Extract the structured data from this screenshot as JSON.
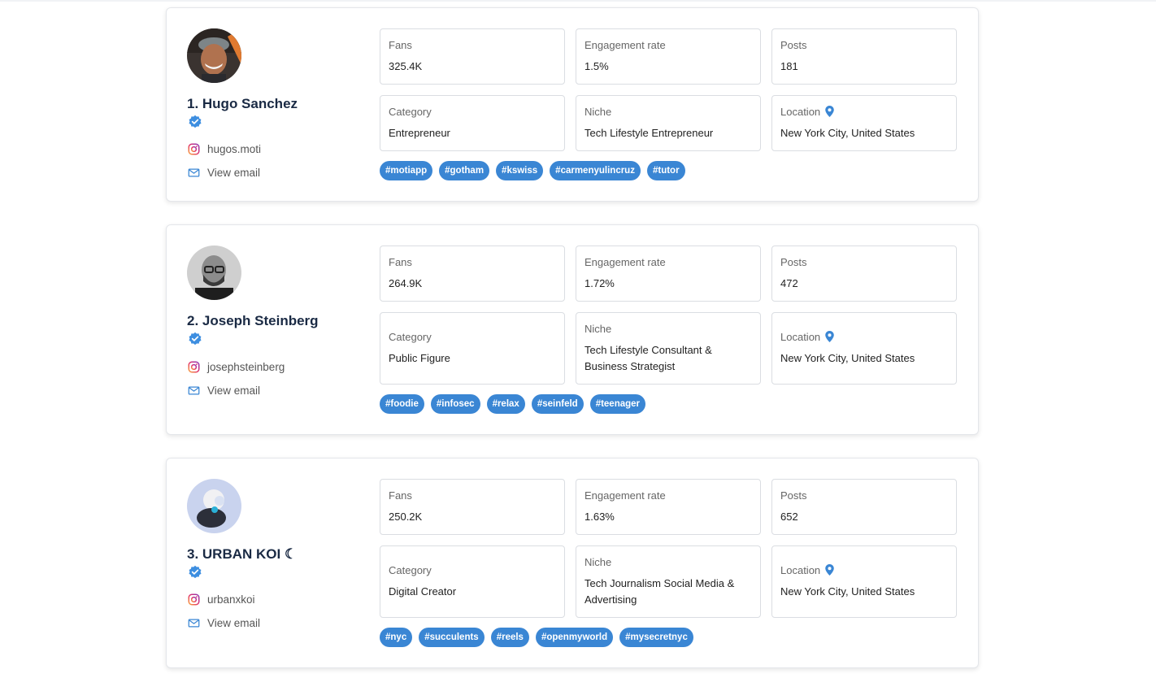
{
  "colors": {
    "accent": "#3a86d4",
    "verified": "#3d8ee0",
    "name": "#1a2a44"
  },
  "influencers": [
    {
      "name": "1. Hugo Sanchez",
      "handle": "hugos.moti",
      "email_link": "View email",
      "fans_label": "Fans",
      "fans": "325.4K",
      "engagement_label": "Engagement rate",
      "engagement": "1.5%",
      "posts_label": "Posts",
      "posts": "181",
      "category_label": "Category",
      "category": "Entrepreneur",
      "niche_label": "Niche",
      "niche": "Tech Lifestyle Entrepreneur",
      "location_label": "Location",
      "location": "New York City, United States",
      "tags": [
        "#motiapp",
        "#gotham",
        "#kswiss",
        "#carmenyulincruz",
        "#tutor"
      ]
    },
    {
      "name": "2. Joseph Steinberg",
      "handle": "josephsteinberg",
      "email_link": "View email",
      "fans_label": "Fans",
      "fans": "264.9K",
      "engagement_label": "Engagement rate",
      "engagement": "1.72%",
      "posts_label": "Posts",
      "posts": "472",
      "category_label": "Category",
      "category": "Public Figure",
      "niche_label": "Niche",
      "niche": "Tech Lifestyle Consultant & Business Strategist",
      "location_label": "Location",
      "location": "New York City, United States",
      "tags": [
        "#foodie",
        "#infosec",
        "#relax",
        "#seinfeld",
        "#teenager"
      ]
    },
    {
      "name": "3. URBAN KOI ☾",
      "handle": "urbanxkoi",
      "email_link": "View email",
      "fans_label": "Fans",
      "fans": "250.2K",
      "engagement_label": "Engagement rate",
      "engagement": "1.63%",
      "posts_label": "Posts",
      "posts": "652",
      "category_label": "Category",
      "category": "Digital Creator",
      "niche_label": "Niche",
      "niche": "Tech Journalism Social Media & Advertising",
      "location_label": "Location",
      "location": "New York City, United States",
      "tags": [
        "#nyc",
        "#succulents",
        "#reels",
        "#openmyworld",
        "#mysecretnyc"
      ]
    }
  ]
}
